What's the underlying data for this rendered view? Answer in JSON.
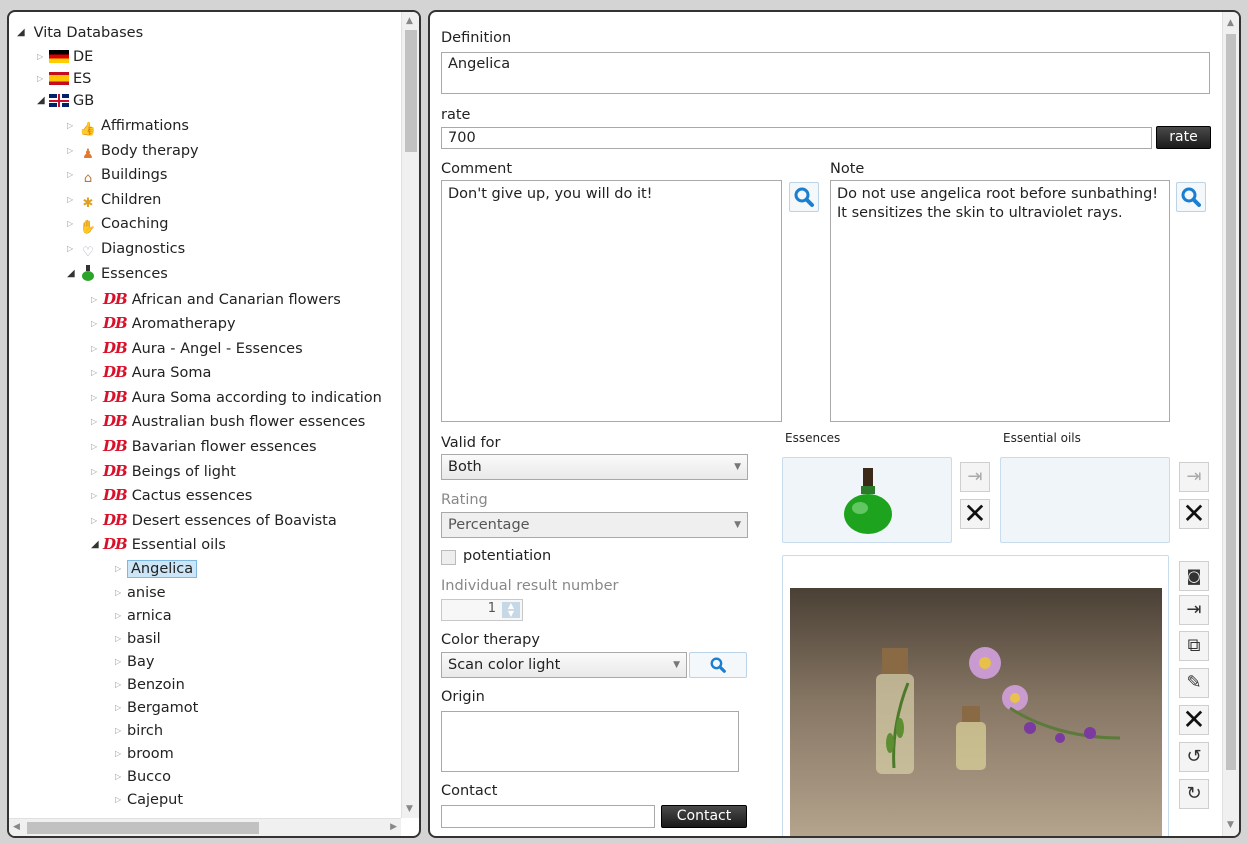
{
  "tree": {
    "root_label": "Vita Databases",
    "countries": [
      {
        "label": "DE",
        "flag": "flag-de-icon"
      },
      {
        "label": "ES",
        "flag": "flag-es-icon"
      },
      {
        "label": "GB",
        "flag": "flag-gb-icon"
      }
    ],
    "categories": [
      {
        "label": "Affirmations",
        "icon": "thumbs-up-icon"
      },
      {
        "label": "Body therapy",
        "icon": "person-icon"
      },
      {
        "label": "Buildings",
        "icon": "house-icon"
      },
      {
        "label": "Children",
        "icon": "children-icon"
      },
      {
        "label": "Coaching",
        "icon": "handshake-icon"
      },
      {
        "label": "Diagnostics",
        "icon": "stethoscope-icon"
      },
      {
        "label": "Essences",
        "icon": "bottle-icon"
      }
    ],
    "essence_dbs": [
      "African and Canarian flowers",
      "Aromatherapy",
      "Aura - Angel - Essences",
      "Aura Soma",
      "Aura Soma according to indication",
      "Australian bush flower essences",
      "Bavarian flower essences",
      "Beings of light",
      "Cactus essences",
      "Desert essences of Boavista",
      "Essential oils"
    ],
    "db_badge": "DB",
    "oils": [
      "Angelica",
      "anise",
      "arnica",
      "basil",
      "Bay",
      "Benzoin",
      "Bergamot",
      "birch",
      "broom",
      "Bucco",
      "Cajeput"
    ],
    "selected": "Angelica"
  },
  "detail": {
    "definition_label": "Definition",
    "definition_value": "Angelica",
    "rate_label": "rate",
    "rate_value": "700",
    "rate_button": "rate",
    "comment_label": "Comment",
    "comment_value": "Don't give up, you will do it!",
    "note_label": "Note",
    "note_value": "Do not use angelica root before sunbathing! It sensitizes the skin to ultraviolet rays.",
    "valid_for_label": "Valid for",
    "valid_for_value": "Both",
    "rating_label": "Rating",
    "rating_value": "Percentage",
    "potentiation_label": "potentiation",
    "individual_label": "Individual result number",
    "individual_value": "1",
    "color_therapy_label": "Color therapy",
    "color_therapy_value": "Scan color light",
    "origin_label": "Origin",
    "origin_value": "",
    "contact_label": "Contact",
    "contact_value": "",
    "contact_button": "Contact",
    "essences_label": "Essences",
    "essential_oils_label": "Essential oils"
  },
  "colors": {
    "accent": "#1a7fd0",
    "selection": "#cde6f7",
    "dark_button": "#222222"
  }
}
